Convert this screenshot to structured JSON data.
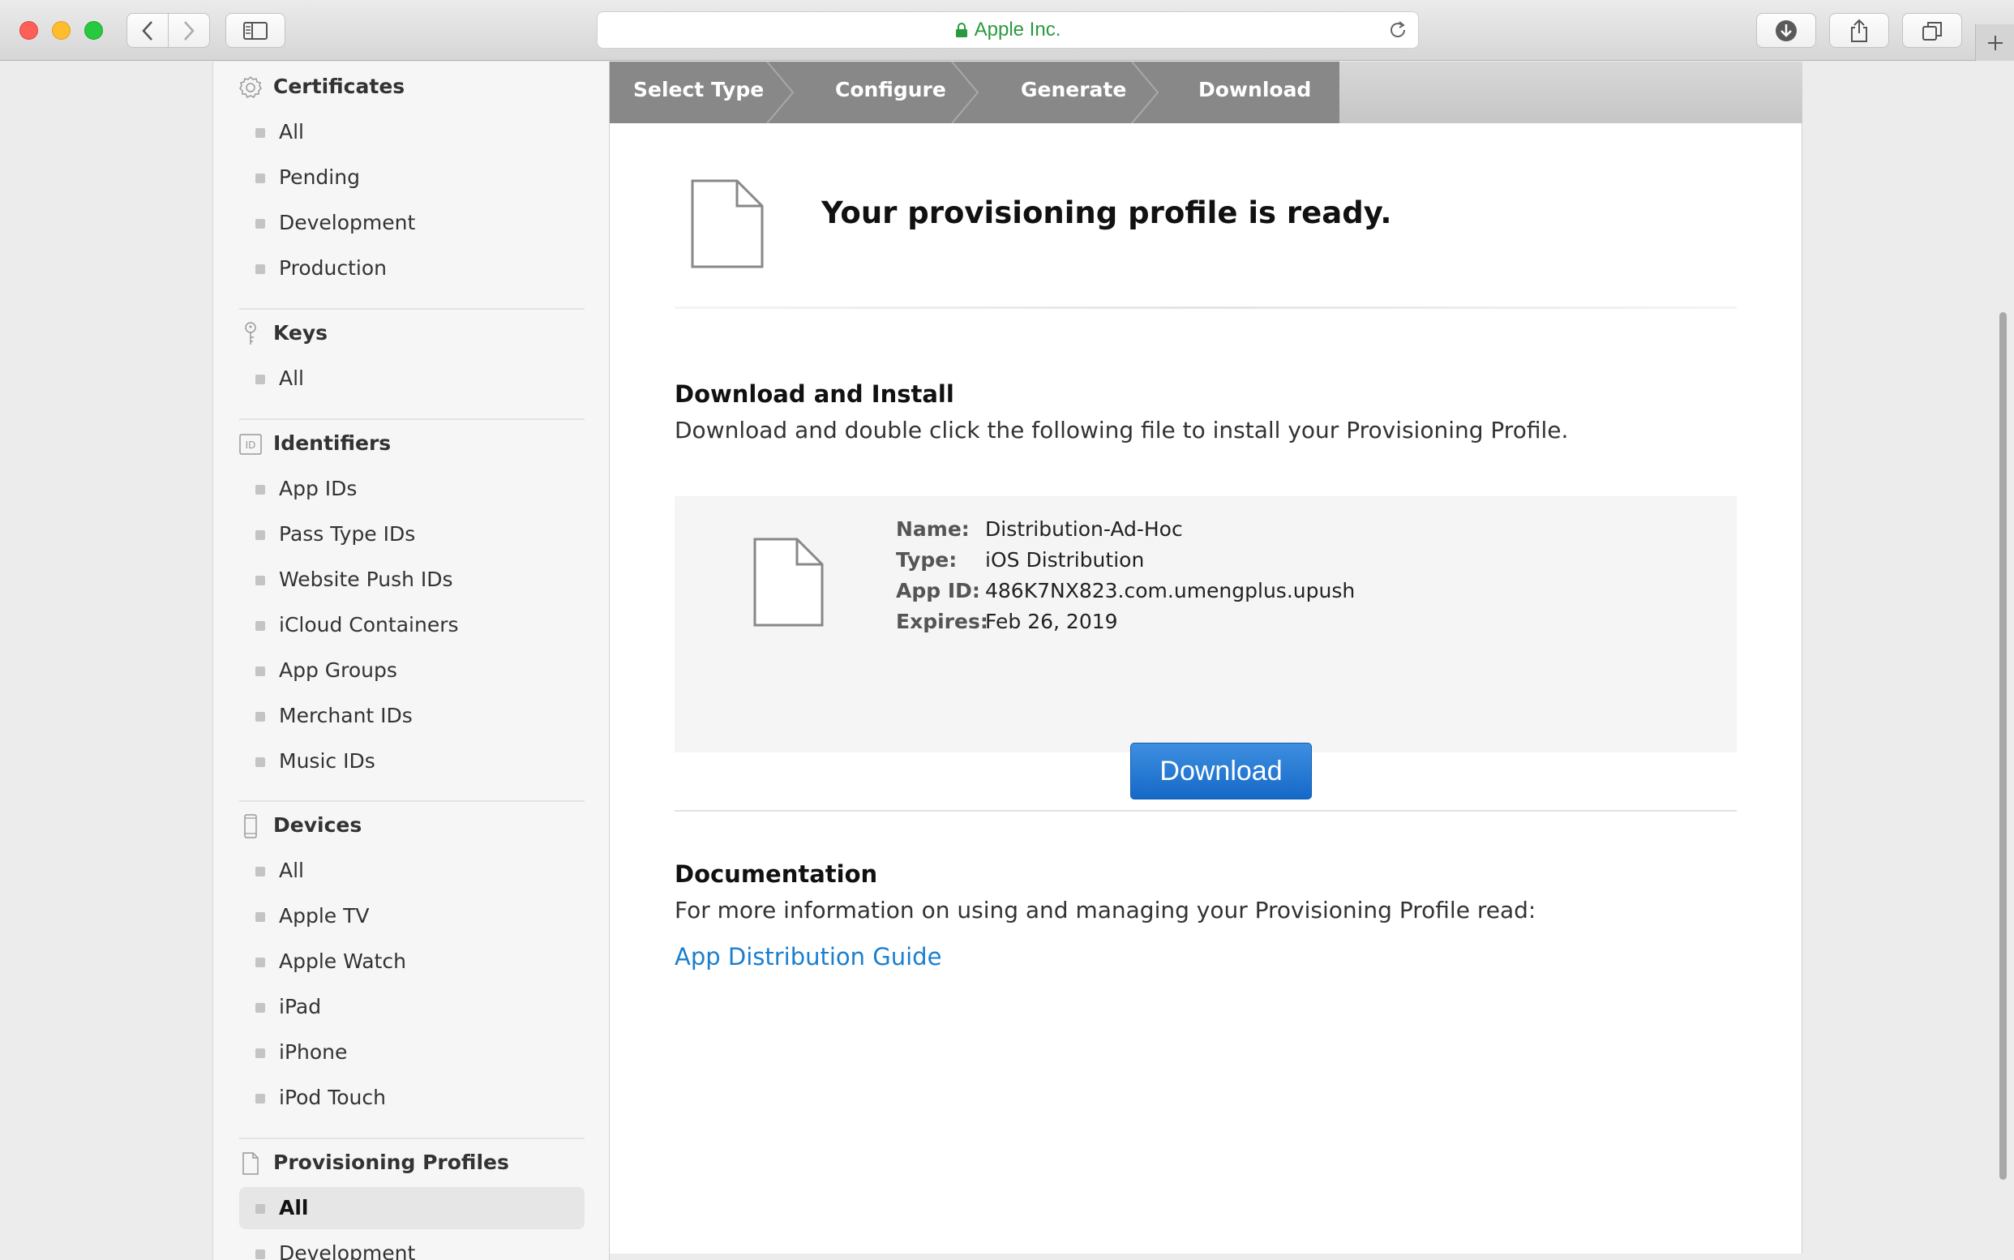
{
  "browser": {
    "url_text": "Apple Inc.",
    "buttons": [
      "back-icon",
      "forward-icon",
      "sidebar-toggle-icon",
      "reload-icon",
      "downloads-icon",
      "share-icon",
      "tabs-overview-icon",
      "new-tab-icon"
    ],
    "colors": {
      "close": "#fe5f57",
      "minimize": "#febc2e",
      "zoom": "#28c840",
      "secure": "#2a9a3e"
    }
  },
  "sidebar": {
    "certificates": {
      "title": "Certificates",
      "items": [
        "All",
        "Pending",
        "Development",
        "Production"
      ]
    },
    "keys": {
      "title": "Keys",
      "items": [
        "All"
      ]
    },
    "identifiers": {
      "title": "Identifiers",
      "icon_text": "ID",
      "items": [
        "App IDs",
        "Pass Type IDs",
        "Website Push IDs",
        "iCloud Containers",
        "App Groups",
        "Merchant IDs",
        "Music IDs"
      ]
    },
    "devices": {
      "title": "Devices",
      "items": [
        "All",
        "Apple TV",
        "Apple Watch",
        "iPad",
        "iPhone",
        "iPod Touch"
      ]
    },
    "profiles": {
      "title": "Provisioning Profiles",
      "items": [
        "All",
        "Development"
      ],
      "active": "All"
    }
  },
  "steps": [
    "Select Type",
    "Configure",
    "Generate",
    "Download"
  ],
  "main": {
    "ready_title": "Your provisioning profile is ready.",
    "install_heading": "Download and Install",
    "install_text": "Download and double click the following file to install your Provisioning Profile.",
    "profile": {
      "name_label": "Name:",
      "name": "Distribution-Ad-Hoc",
      "type_label": "Type:",
      "type": "iOS Distribution",
      "appid_label": "App ID:",
      "appid": "486K7NX823.com.umengplus.upush",
      "expires_label": "Expires:",
      "expires": "Feb 26, 2019"
    },
    "download_button": "Download",
    "doc_heading": "Documentation",
    "doc_text": "For more information on using and managing your Provisioning Profile read:",
    "doc_link": "App Distribution Guide"
  }
}
